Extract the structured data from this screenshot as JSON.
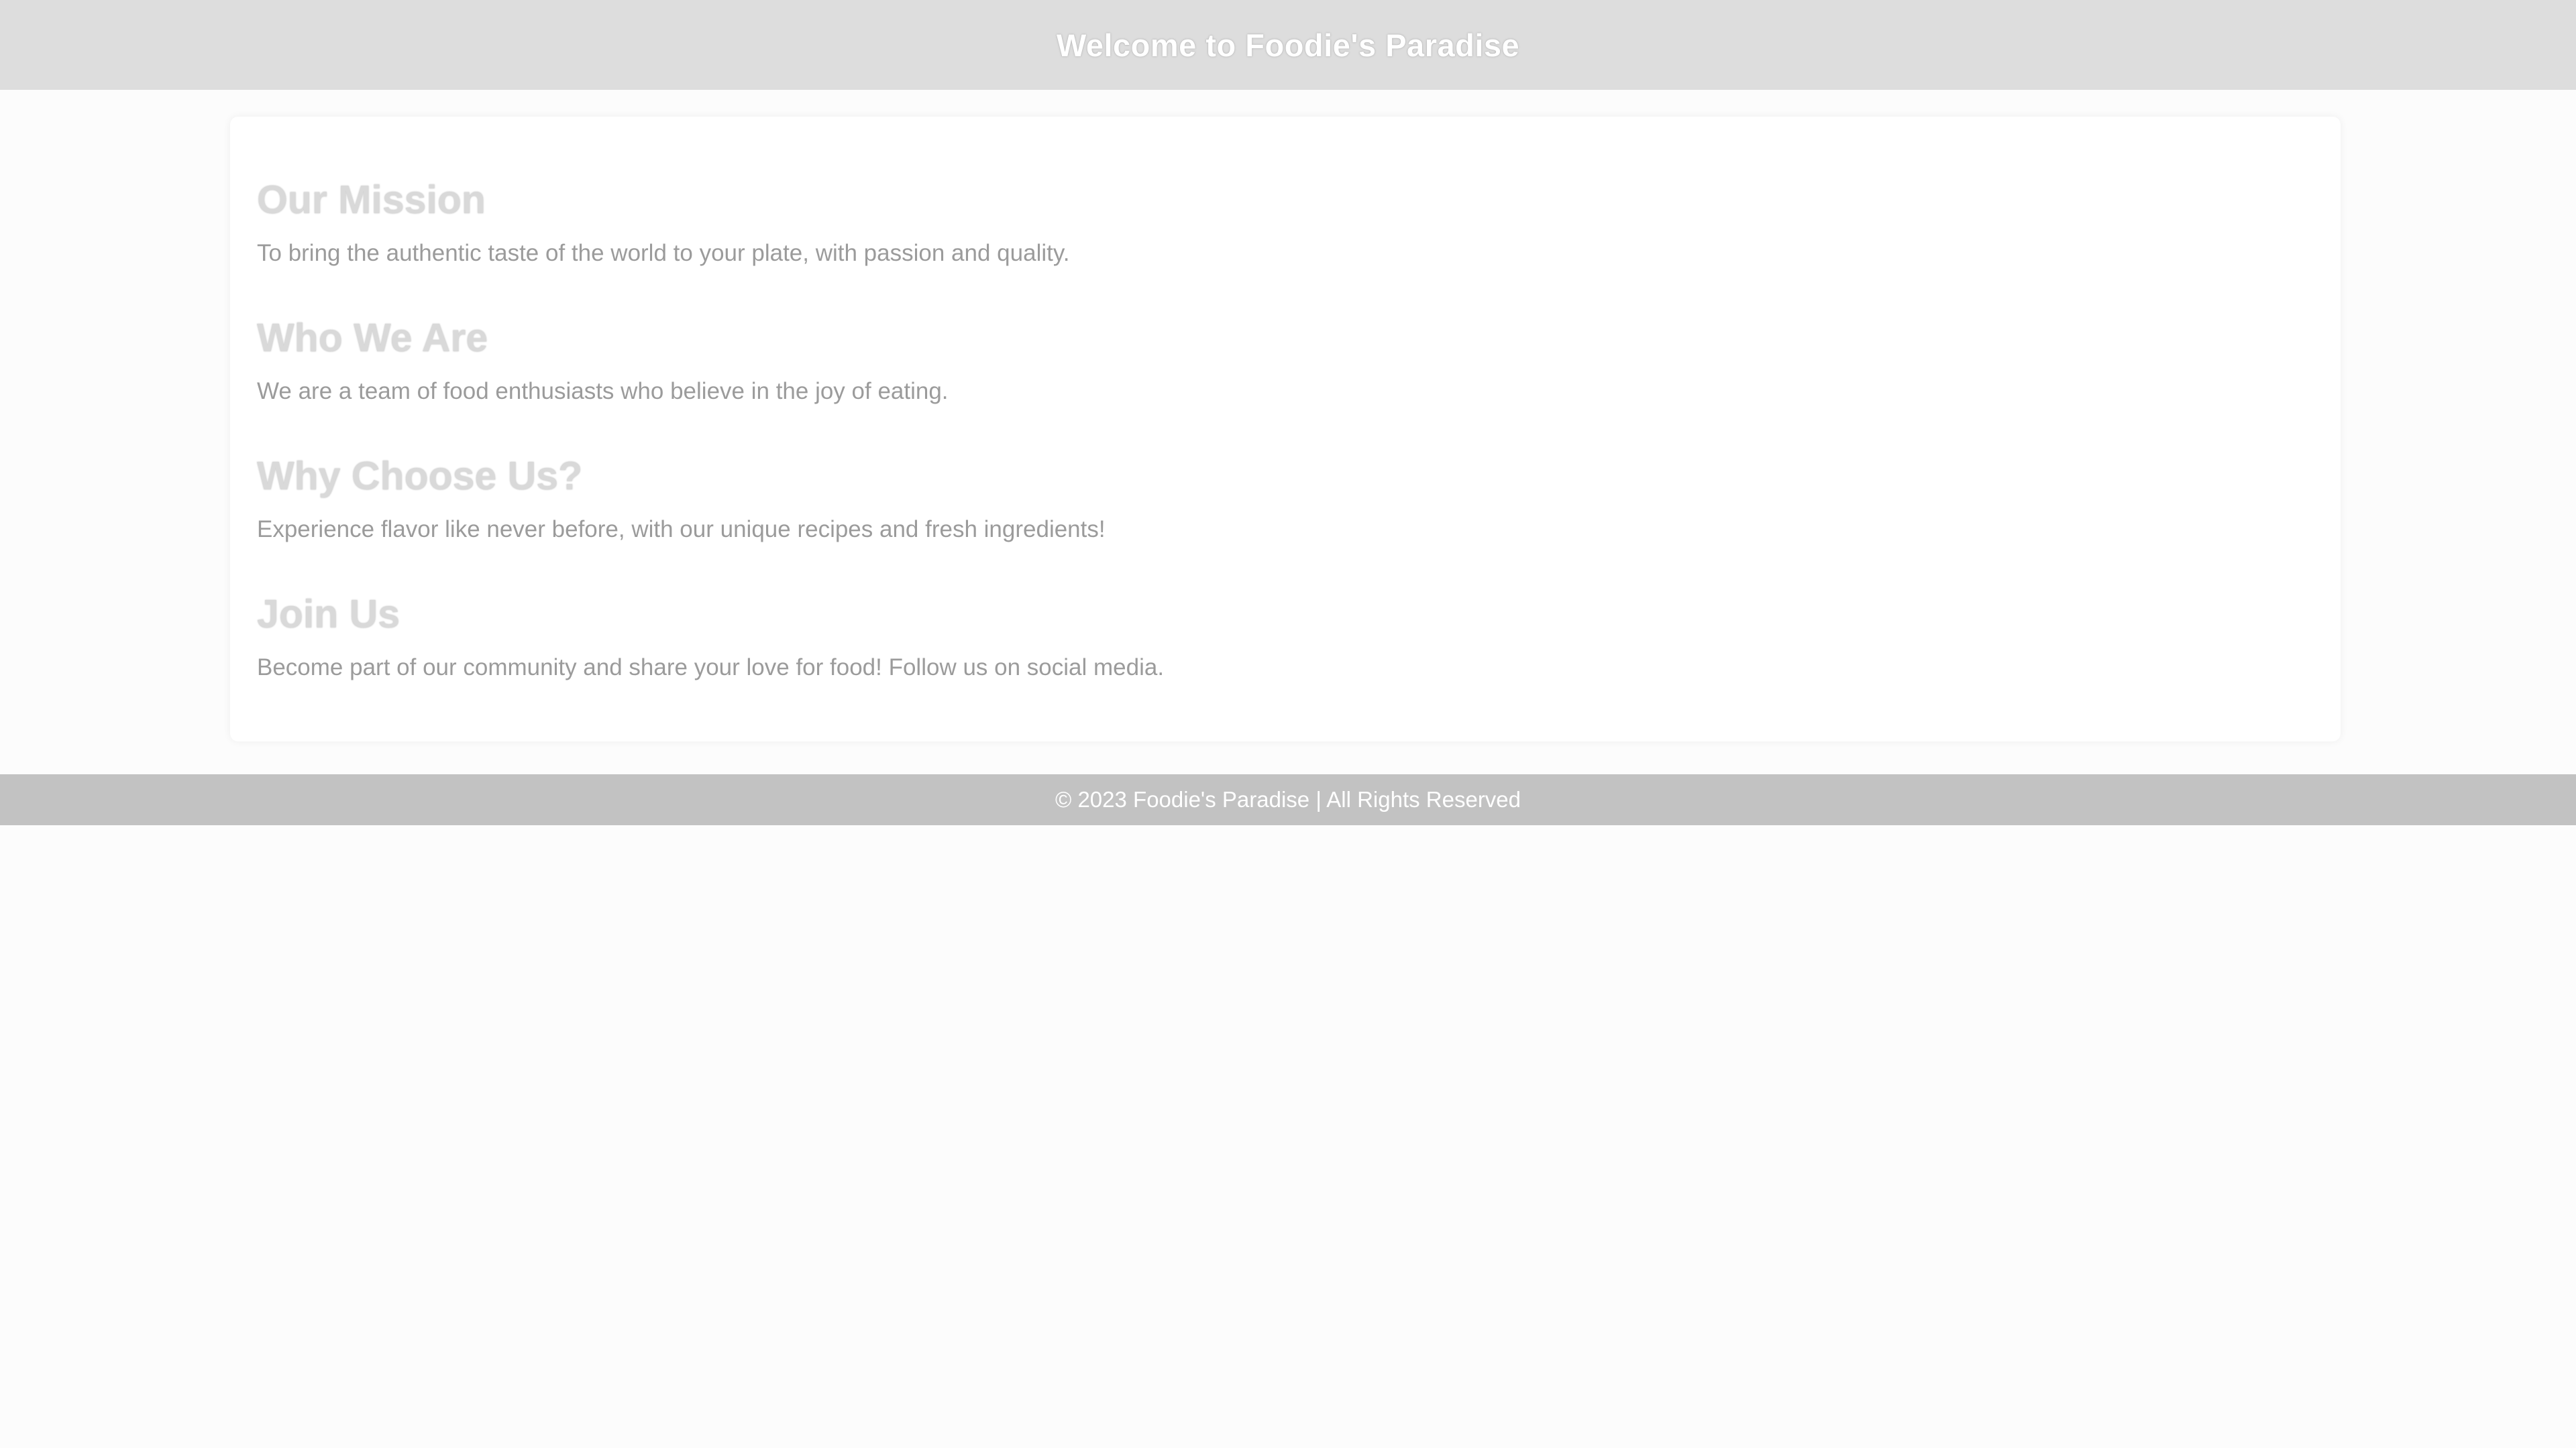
{
  "header": {
    "title": "Welcome to Foodie's Paradise"
  },
  "sections": [
    {
      "heading": "Our Mission",
      "text": "To bring the authentic taste of the world to your plate, with passion and quality."
    },
    {
      "heading": "Who We Are",
      "text": "We are a team of food enthusiasts who believe in the joy of eating."
    },
    {
      "heading": "Why Choose Us?",
      "text": "Experience flavor like never before, with our unique recipes and fresh ingredients!"
    },
    {
      "heading": "Join Us",
      "text": "Become part of our community and share your love for food! Follow us on social media."
    }
  ],
  "footer": {
    "text": "© 2023 Foodie's Paradise | All Rights Reserved"
  },
  "colors": {
    "header_bg": "#dddddd",
    "footer_bg": "#c2c2c2",
    "page_bg": "#fcfcfc",
    "card_bg": "#ffffff"
  }
}
